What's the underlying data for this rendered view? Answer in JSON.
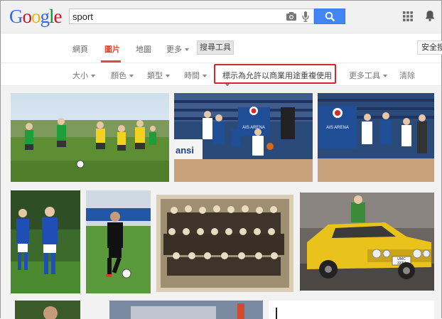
{
  "logo": {
    "letters": [
      "G",
      "o",
      "o",
      "g",
      "l",
      "e"
    ]
  },
  "search": {
    "query": "sport"
  },
  "nav": {
    "items": [
      "網頁",
      "圖片",
      "地圖",
      "更多",
      "搜尋工具"
    ],
    "safe_search": "安全搜"
  },
  "filters": {
    "items": [
      "大小",
      "顏色",
      "類型",
      "時間"
    ],
    "license": "標示為允許以商業用途重複使用",
    "more_tools": "更多工具",
    "clear": "清除"
  },
  "images": {
    "arena_label": "AIS ARENA",
    "arena_label_2": "AIS ARENA",
    "arena_banner": "ansi",
    "plate_1": "UMC",
    "plate_2": "333H"
  },
  "icons": [
    "camera-icon",
    "microphone-icon",
    "search-icon",
    "apps-grid-icon",
    "notifications-bell-icon"
  ],
  "colors": {
    "accent_red": "#dd4b39",
    "search_blue": "#4285f4",
    "highlight_red": "#d9262a"
  }
}
